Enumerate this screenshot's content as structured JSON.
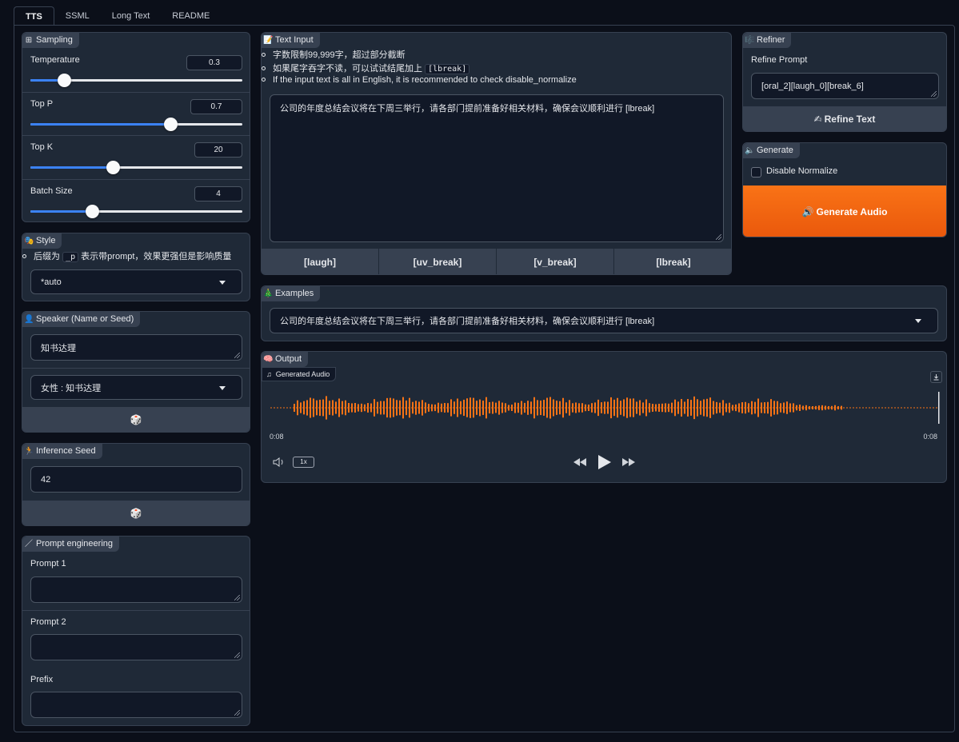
{
  "tabs": [
    "TTS",
    "SSML",
    "Long Text",
    "README"
  ],
  "sampling": {
    "title": "Sampling",
    "icon": "grid-icon",
    "params": [
      {
        "label": "Temperature",
        "value": "0.3",
        "fraction": 0.16
      },
      {
        "label": "Top P",
        "value": "0.7",
        "fraction": 0.66
      },
      {
        "label": "Top K",
        "value": "20",
        "fraction": 0.39
      },
      {
        "label": "Batch Size",
        "value": "4",
        "fraction": 0.29
      }
    ]
  },
  "style": {
    "title": "Style",
    "icon": "theater-masks-icon",
    "note_pre": "后缀为",
    "note_code": "_p",
    "note_post": "表示带prompt，效果更强但是影响质量",
    "selected": "*auto"
  },
  "speaker": {
    "title": "Speaker (Name or Seed)",
    "icon": "person-icon",
    "name_value": "知书达理",
    "selected": "女性 : 知书达理",
    "dice_icon": "dice-icon"
  },
  "inference": {
    "title": "Inference Seed",
    "icon": "person-running-icon",
    "seed_value": "42",
    "dice_icon": "dice-icon"
  },
  "prompt_engineering": {
    "title": "Prompt engineering",
    "icon": "wand-icon",
    "prompt1_label": "Prompt 1",
    "prompt2_label": "Prompt 2",
    "prefix_label": "Prefix"
  },
  "text_input": {
    "title": "Text Input",
    "icon": "memo-icon",
    "notes": [
      "字数限制99,999字，超过部分截断",
      "如果尾字吞字不读，可以试试结尾加上",
      "If the input text is all in English, it is recommended to check disable_normalize"
    ],
    "note_code": "[lbreak]",
    "value": "公司的年度总结会议将在下周三举行，请各部门提前准备好相关材料，确保会议顺利进行 [lbreak]",
    "buttons": [
      "[laugh]",
      "[uv_break]",
      "[v_break]",
      "[lbreak]"
    ]
  },
  "refiner": {
    "title": "Refiner",
    "icon": "notes-icon",
    "prompt_label": "Refine Prompt",
    "prompt_value": "[oral_2][laugh_0][break_6]",
    "button": "Refine Text",
    "button_icon": "writing-hand-icon"
  },
  "generate": {
    "title": "Generate",
    "icon": "speaker-icon",
    "checkbox_label": "Disable Normalize",
    "checked": false,
    "button": "Generate Audio",
    "button_icon": "loudspeaker-icon",
    "accent": "#f97316"
  },
  "examples": {
    "title": "Examples",
    "icon": "tree-icon",
    "selected": "公司的年度总结会议将在下周三举行，请各部门提前准备好相关材料，确保会议顺利进行 [lbreak]"
  },
  "output": {
    "title": "Output",
    "icon": "brain-icon",
    "audio_label": "Generated Audio",
    "time_current": "0:08",
    "time_total": "0:08",
    "rate": "1x",
    "waveform_color": "#f97316"
  }
}
